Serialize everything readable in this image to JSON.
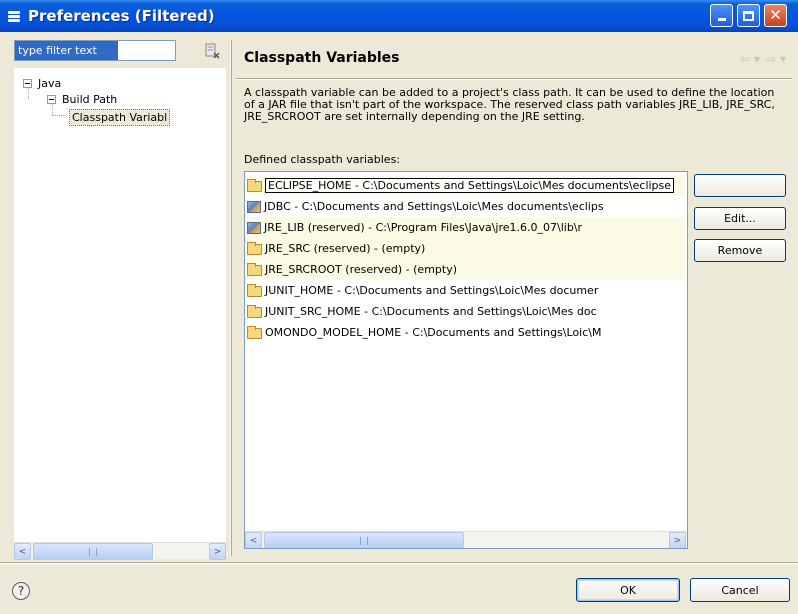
{
  "window": {
    "title": "Preferences (Filtered)",
    "icon": "preferences-icon"
  },
  "filter": {
    "value": "type filter text",
    "clear_icon": "clear-filter-icon"
  },
  "tree": {
    "items": [
      {
        "label": "Java",
        "expander": "minus"
      },
      {
        "label": "Build Path",
        "expander": "minus"
      },
      {
        "label": "Classpath Variabl"
      }
    ]
  },
  "page": {
    "title": "Classpath Variables",
    "description": "A classpath variable can be added to a project's class path. It can be used to define the location of a JAR file that isn't part of the workspace. The reserved class path variables JRE_LIB, JRE_SRC, JRE_SRCROOT are set internally depending on the JRE setting.",
    "list_label": "Defined classpath variables:"
  },
  "variables": [
    {
      "text": "ECLIPSE_HOME - C:\\Documents and Settings\\Loic\\Mes documents\\eclipse",
      "icon": "folder-icon"
    },
    {
      "text": "JDBC - C:\\Documents and Settings\\Loic\\Mes documents\\eclips",
      "icon": "jar-icon"
    },
    {
      "text": "JRE_LIB (reserved) - C:\\Program Files\\Java\\jre1.6.0_07\\lib\\r",
      "icon": "jar-icon"
    },
    {
      "text": "JRE_SRC (reserved) - (empty)",
      "icon": "folder-icon"
    },
    {
      "text": "JRE_SRCROOT (reserved) - (empty)",
      "icon": "folder-icon"
    },
    {
      "text": "JUNIT_HOME - C:\\Documents and Settings\\Loic\\Mes documer",
      "icon": "folder-icon"
    },
    {
      "text": "JUNIT_SRC_HOME - C:\\Documents and Settings\\Loic\\Mes doc",
      "icon": "folder-icon"
    },
    {
      "text": "OMONDO_MODEL_HOME - C:\\Documents and Settings\\Loic\\M",
      "icon": "folder-icon"
    }
  ],
  "buttons": {
    "new": "",
    "edit": "Edit...",
    "remove": "Remove",
    "ok": "OK",
    "cancel": "Cancel"
  },
  "scroll": {
    "left_arrow": "<",
    "right_arrow": ">"
  }
}
